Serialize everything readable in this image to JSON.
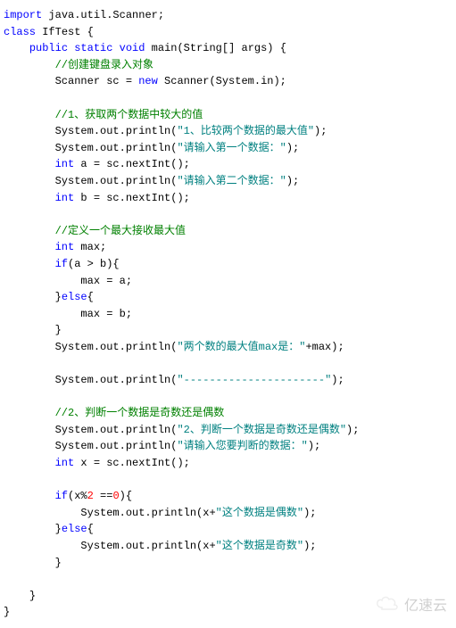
{
  "code": {
    "l01_import": "import",
    "l01_rest": " java.util.Scanner;",
    "l02_class": "class",
    "l02_rest": " IfTest {",
    "l03_indent": "    ",
    "l03_public": "public",
    "l03_sp1": " ",
    "l03_static": "static",
    "l03_sp2": " ",
    "l03_void": "void",
    "l03_rest": " main(String[] args) {",
    "l04_indent": "        ",
    "l04_comment": "//创建键盘录入对象",
    "l05_indent": "        ",
    "l05_a": "Scanner sc = ",
    "l05_new": "new",
    "l05_b": " Scanner(System.in);",
    "l06_blank": " ",
    "l07_indent": "        ",
    "l07_comment": "//1、获取两个数据中较大的值",
    "l08_indent": "        ",
    "l08_a": "System.out.println(",
    "l08_str": "\"1、比较两个数据的最大值\"",
    "l08_b": ");",
    "l09_indent": "        ",
    "l09_a": "System.out.println(",
    "l09_str": "\"请输入第一个数据：\"",
    "l09_b": ");",
    "l10_indent": "        ",
    "l10_int": "int",
    "l10_rest": " a = sc.nextInt();",
    "l11_indent": "        ",
    "l11_a": "System.out.println(",
    "l11_str": "\"请输入第二个数据：\"",
    "l11_b": ");",
    "l12_indent": "        ",
    "l12_int": "int",
    "l12_rest": " b = sc.nextInt();",
    "l13_blank": " ",
    "l14_indent": "        ",
    "l14_comment": "//定义一个最大接收最大值",
    "l15_indent": "        ",
    "l15_int": "int",
    "l15_rest": " max;",
    "l16_indent": "        ",
    "l16_if": "if",
    "l16_rest": "(a > b){",
    "l17_indent": "            ",
    "l17_rest": "max = a;",
    "l18_indent": "        ",
    "l18_else_a": "}",
    "l18_else": "else",
    "l18_else_b": "{",
    "l19_indent": "            ",
    "l19_rest": "max = b;",
    "l20_indent": "        ",
    "l20_rest": "}",
    "l21_indent": "        ",
    "l21_a": "System.out.println(",
    "l21_str": "\"两个数的最大值max是：\"",
    "l21_b": "+max);",
    "l22_blank": " ",
    "l23_indent": "        ",
    "l23_a": "System.out.println(",
    "l23_str": "\"----------------------\"",
    "l23_b": ");",
    "l24_blank": " ",
    "l25_indent": "        ",
    "l25_comment": "//2、判断一个数据是奇数还是偶数",
    "l26_indent": "        ",
    "l26_a": "System.out.println(",
    "l26_str": "\"2、判断一个数据是奇数还是偶数\"",
    "l26_b": ");",
    "l27_indent": "        ",
    "l27_a": "System.out.println(",
    "l27_str": "\"请输入您要判断的数据：\"",
    "l27_b": ");",
    "l28_indent": "        ",
    "l28_int": "int",
    "l28_rest": " x = sc.nextInt();",
    "l29_blank": " ",
    "l30_indent": "        ",
    "l30_if": "if",
    "l30_a": "(x%",
    "l30_num1": "2",
    "l30_b": " ==",
    "l30_num2": "0",
    "l30_c": "){",
    "l31_indent": "            ",
    "l31_a": "System.out.println(x+",
    "l31_str": "\"这个数据是偶数\"",
    "l31_b": ");",
    "l32_indent": "        ",
    "l32_else_a": "}",
    "l32_else": "else",
    "l32_else_b": "{",
    "l33_indent": "            ",
    "l33_a": "System.out.println(x+",
    "l33_str": "\"这个数据是奇数\"",
    "l33_b": ");",
    "l34_indent": "        ",
    "l34_rest": "}",
    "l35_blank": " ",
    "l36_indent": "    ",
    "l36_rest": "}",
    "l37_rest": "}"
  },
  "watermark": "亿速云"
}
